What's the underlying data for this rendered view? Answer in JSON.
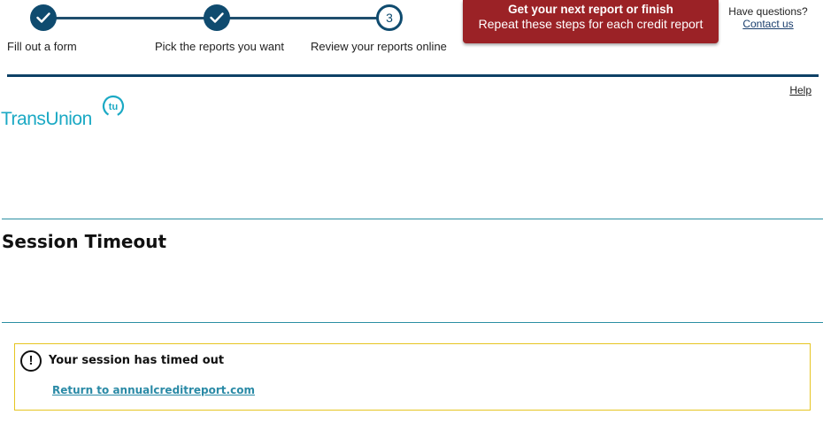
{
  "progress": {
    "steps": [
      {
        "label": "Fill out a form",
        "state": "done",
        "icon": "check-icon"
      },
      {
        "label": "Pick the reports you want",
        "state": "done",
        "icon": "check-icon"
      },
      {
        "label": "Review your reports online",
        "state": "current",
        "number": "3"
      }
    ]
  },
  "next_box": {
    "title": "Get your next report or finish",
    "subtitle": "Repeat these steps for each credit report"
  },
  "questions": {
    "text": "Have questions?",
    "link": "Contact us"
  },
  "help_link": "Help",
  "logo": {
    "text": "TransUnion",
    "mark_text": "tu",
    "color": "#1ba9c4"
  },
  "page_title": "Session Timeout",
  "alert": {
    "icon": "exclamation-circle-icon",
    "title": "Your session has timed out",
    "link": "Return to annualcreditreport.com",
    "border_color": "#e6c522"
  },
  "colors": {
    "progress": "#0f4b6f",
    "next_box": "#9b2226",
    "teal_rule": "#2b8fa3",
    "link": "#2a8aa6"
  }
}
